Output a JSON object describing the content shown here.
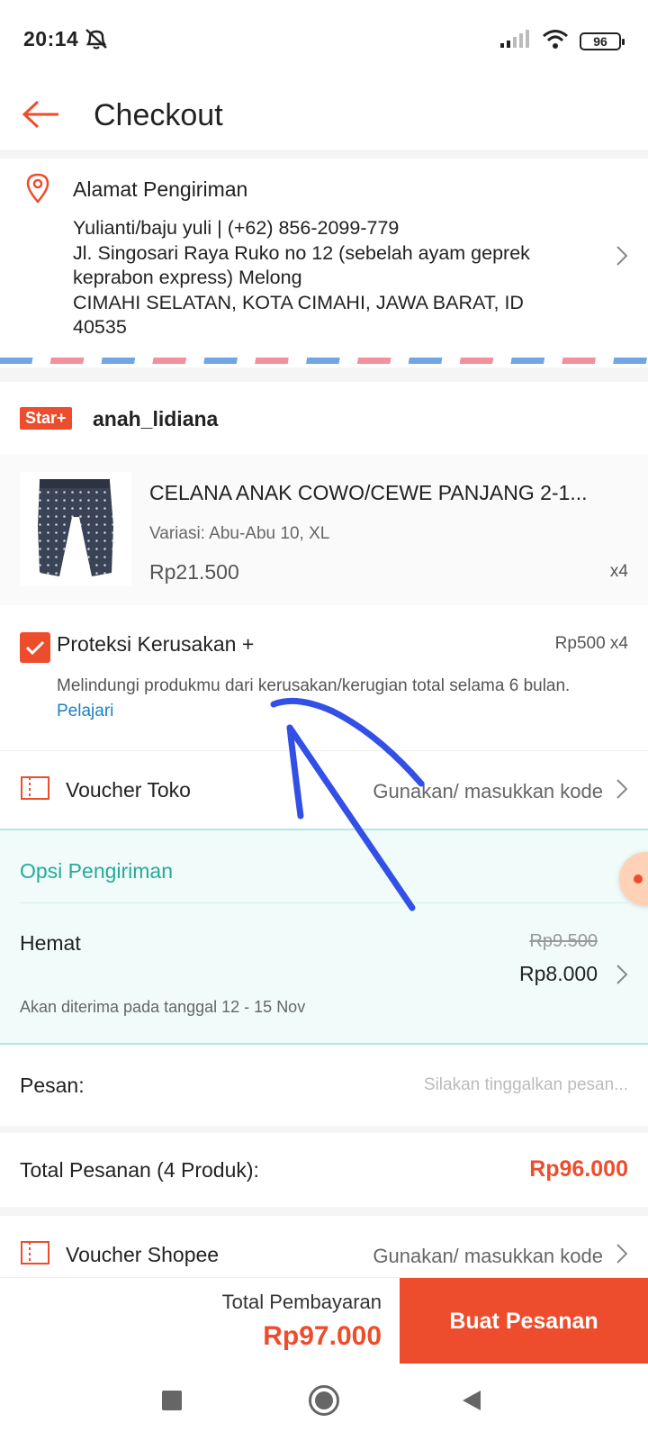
{
  "status": {
    "time": "20:14",
    "battery": "96"
  },
  "header": {
    "title": "Checkout"
  },
  "address": {
    "title": "Alamat Pengiriman",
    "lines": [
      "Yulianti/baju yuli | (+62) 856-2099-779",
      "Jl. Singosari Raya Ruko no 12 (sebelah ayam geprek",
      "keprabon express) Melong",
      "CIMAHI SELATAN, KOTA CIMAHI, JAWA BARAT, ID",
      "40535"
    ]
  },
  "shop": {
    "badge": "Star+",
    "name": "anah_lidiana"
  },
  "product": {
    "name": "CELANA ANAK COWO/CEWE PANJANG 2-1...",
    "variant": "Variasi: Abu-Abu 10, XL",
    "price": "Rp21.500",
    "qty": "x4"
  },
  "protection": {
    "checked": true,
    "title": "Proteksi Kerusakan +",
    "price": "Rp500  x4",
    "desc": "Melindungi produkmu dari kerusakan/kerugian total selama 6 bulan.",
    "link": "Pelajari"
  },
  "voucher_toko": {
    "label": "Voucher Toko",
    "hint": "Gunakan/ masukkan kode"
  },
  "shipping": {
    "title": "Opsi Pengiriman",
    "option": "Hemat",
    "old_price": "Rp9.500",
    "price": "Rp8.000",
    "eta": "Akan diterima pada tanggal 12 - 15 Nov"
  },
  "message": {
    "label": "Pesan:",
    "placeholder": "Silakan tinggalkan pesan..."
  },
  "order_total": {
    "label": "Total Pesanan (4 Produk):",
    "value": "Rp96.000"
  },
  "voucher_shopee": {
    "label": "Voucher Shopee",
    "hint": "Gunakan/ masukkan kode"
  },
  "payment": {
    "label": "Total Pembayaran",
    "value": "Rp97.000",
    "button": "Buat Pesanan"
  },
  "colors": {
    "accent": "#ee4d2d",
    "teal": "#26aa99",
    "link": "#1a82c4",
    "annotation": "#3350e6"
  }
}
